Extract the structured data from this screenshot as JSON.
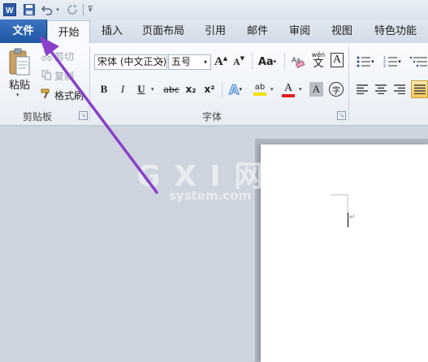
{
  "qat": {
    "app_icon": "word-icon",
    "save_icon": "save-icon",
    "undo_icon": "undo-icon",
    "redo_icon": "redo-icon",
    "customize_icon": "customize-qat-icon"
  },
  "tabs": [
    "文件",
    "开始",
    "插入",
    "页面布局",
    "引用",
    "邮件",
    "审阅",
    "视图",
    "特色功能"
  ],
  "clipboard": {
    "paste_label": "粘贴",
    "cut_label": "剪切",
    "copy_label": "复制",
    "format_painter_label": "格式刷",
    "group_label": "剪贴板"
  },
  "font": {
    "font_name": "宋体 (中文正文)",
    "font_size": "五号",
    "grow_label": "A",
    "shrink_label": "A",
    "change_case_label": "Aa",
    "bold": "B",
    "italic": "I",
    "underline": "U",
    "strike": "abc",
    "subscript": "x₂",
    "superscript": "x²",
    "text_effect": "A",
    "highlight": "ab",
    "font_color": "A",
    "char_shading": "A",
    "enclosed_char": "字",
    "phonetic_guide": "wén",
    "phonetic_char": "文",
    "group_label": "字体"
  },
  "watermark": {
    "logo": "G X I 网",
    "domain": "system.com"
  },
  "colors": {
    "file_tab": "#2a62b2",
    "arrow": "#8a3fc8",
    "highlight": "#f5e000",
    "font_color": "#e02020"
  }
}
